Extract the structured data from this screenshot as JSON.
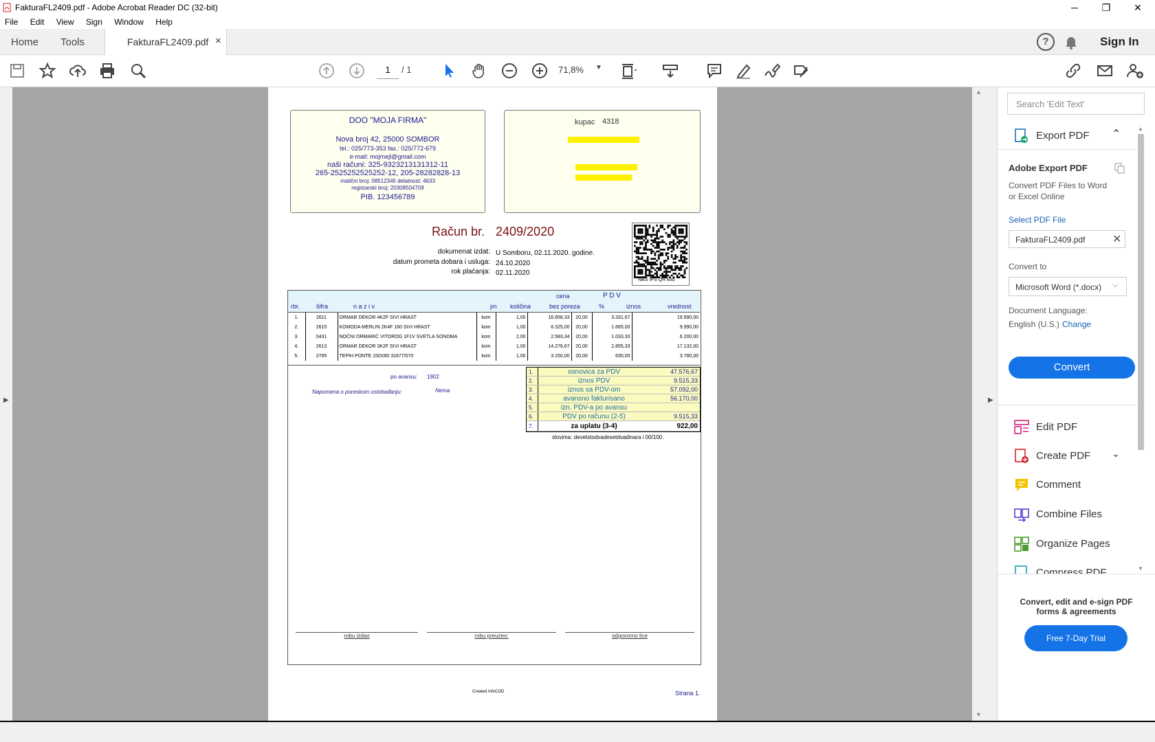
{
  "window": {
    "title": "FakturaFL2409.pdf - Adobe Acrobat Reader DC (32-bit)",
    "minimize": "─",
    "maximize": "❐",
    "close": "✕"
  },
  "menu": [
    "File",
    "Edit",
    "View",
    "Sign",
    "Window",
    "Help"
  ],
  "tabs": {
    "home": "Home",
    "tools": "Tools",
    "document": "FakturaFL2409.pdf",
    "close": "×"
  },
  "header_right": {
    "sign_in": "Sign In",
    "help": "?"
  },
  "toolbar": {
    "page_current": "1",
    "page_total": "/ 1",
    "zoom": "71,8%"
  },
  "right_panel": {
    "search_placeholder": "Search 'Edit Text'",
    "export_pdf": "Export PDF",
    "adobe_export_title": "Adobe Export PDF",
    "adobe_export_desc1": "Convert PDF Files to Word",
    "adobe_export_desc2": "or Excel Online",
    "select_pdf_file": "Select PDF File",
    "selected_file": "FakturaFL2409.pdf",
    "convert_to": "Convert to",
    "convert_format": "Microsoft Word (*.docx)",
    "doc_language": "Document Language:",
    "language": "English (U.S.)",
    "change": "Change",
    "convert_button": "Convert",
    "tools": [
      "Edit PDF",
      "Create PDF",
      "Comment",
      "Combine Files",
      "Organize Pages",
      "Compress PDF"
    ],
    "promo1": "Convert, edit and e-sign PDF",
    "promo2": "forms & agreements",
    "trial": "Free 7-Day Trial"
  },
  "invoice": {
    "company": {
      "name": "DOO \"MOJA FIRMA\"",
      "address": "Nova broj 42, 25000 SOMBOR",
      "tel": "tel.: 025/773-353  fax.: 025/772-679",
      "email": "e-mail: mojmejl@gmail.com",
      "accounts1": "naši računi:  325-9323213131312-11",
      "accounts2": "265-2525252525252-12, 205-28282828-13",
      "reg1": "matični broj: 08512345  delatnost: 4633",
      "reg2": "registarski broj: 20308504709",
      "pib": "PIB. 123456789"
    },
    "buyer": {
      "label": "kupac",
      "code": "4318"
    },
    "title": "Račun  br.",
    "number": "2409/2020",
    "meta": [
      {
        "label": "dokumenat izdat:",
        "value": "U Somboru, 02.11.2020. godine."
      },
      {
        "label": "datum prometa dobara i usluga:",
        "value": "24.10.2020"
      },
      {
        "label": "rok plaćanja:",
        "value": "02.11.2020"
      }
    ],
    "qr_caption": "NBS  IPS QR kod",
    "head_top": {
      "cena": "cena",
      "pdv": "P D V"
    },
    "headers": [
      "rbr.",
      "šifra",
      "n a z i v",
      "jm",
      "količina",
      "bez poreza",
      "%",
      "iznos",
      "vrednost"
    ],
    "rows": [
      [
        "1.",
        "2611",
        "ORMAR DEKOR 4K2F SIVI HRAST",
        "kom",
        "1,00",
        "16.658,33",
        "20,00",
        "3.331,67",
        "19.990,00"
      ],
      [
        "2.",
        "2615",
        "KOMODA MERLIN 2K4F 160 SIVI HRAST",
        "kom",
        "1,00",
        "8.325,00",
        "20,00",
        "1.665,00",
        "9.990,00"
      ],
      [
        "3.",
        "0431",
        "NOĆNI ORMARIĆ VITOROG 1F1V SVETLA SONOMA",
        "kom",
        "2,00",
        "2.583,34",
        "20,00",
        "1.033,33",
        "6.200,00"
      ],
      [
        "4.",
        "2613",
        "ORMAR DEKOR 3K2F SIVI HRAST",
        "kom",
        "1,00",
        "14.276,67",
        "20,00",
        "2.855,33",
        "17.132,00"
      ],
      [
        "5.",
        "2765",
        "TEPIH PONTE 150X80 31677/070",
        "kom",
        "1,00",
        "3.150,00",
        "20,00",
        "630,00",
        "3.780,00"
      ]
    ],
    "advance_label": "po avansu:",
    "advance_value": "1902",
    "note_label": "Napomena o poreskom oslobađanju:",
    "note_value": "Nema",
    "totals": [
      {
        "n": "1.",
        "label": "osnovica za PDV",
        "value": "47.576,67"
      },
      {
        "n": "2.",
        "label": "iznos PDV",
        "value": "9.515,33"
      },
      {
        "n": "3.",
        "label": "iznos sa PDV-om",
        "value": "57.092,00"
      },
      {
        "n": "4.",
        "label": "avansno fakturisano",
        "value": "56.170,00"
      },
      {
        "n": "5.",
        "label": "izn. PDV-a po avansu",
        "value": ""
      },
      {
        "n": "6.",
        "label": "PDV po računu (2-5)",
        "value": "9.515,33"
      },
      {
        "n": "7.",
        "label": "za uplatu (3-4)",
        "value": "922,00"
      }
    ],
    "words": "slovima:   devetstodvadesetdvadinara i  00/100.",
    "sig1": "robu izdao",
    "sig2": "robu preuzeo:",
    "sig3": "odgovorno lice",
    "created": "Created  InfoCOD",
    "page_label": "Strana  1."
  }
}
